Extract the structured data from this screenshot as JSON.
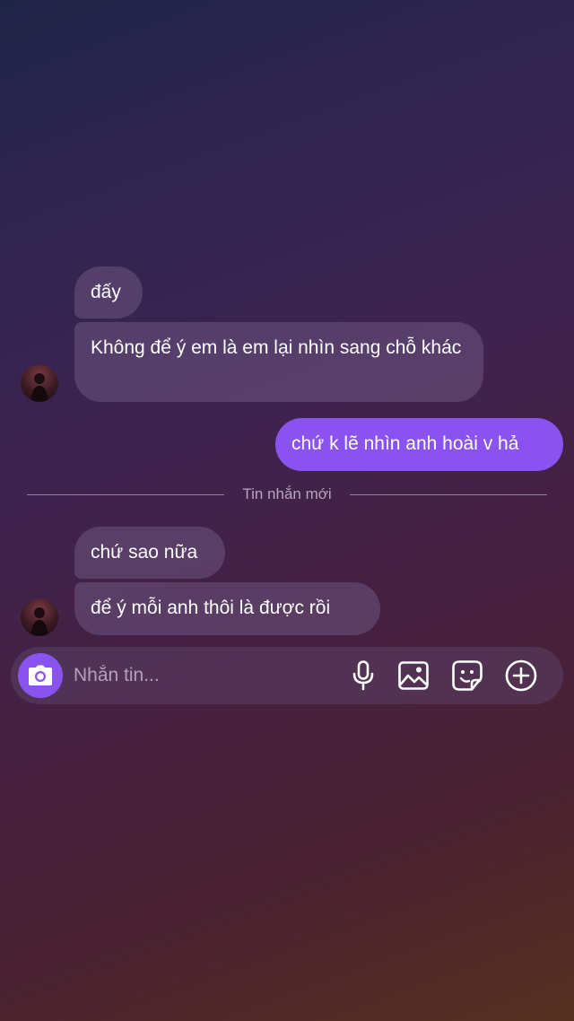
{
  "messages": [
    {
      "id": "m1",
      "direction": "incoming",
      "text": "đấy"
    },
    {
      "id": "m2",
      "direction": "incoming",
      "text": "Không để ý em là em lại nhìn sang chỗ khác"
    },
    {
      "id": "m3",
      "direction": "outgoing",
      "text": "chứ k lẽ nhìn anh hoài v hả"
    },
    {
      "id": "m4",
      "direction": "incoming",
      "text": "chứ sao nữa"
    },
    {
      "id": "m5",
      "direction": "incoming",
      "text": "để ý mỗi anh thôi là được rồi"
    }
  ],
  "divider": {
    "label": "Tin nhắn mới"
  },
  "composer": {
    "placeholder": "Nhắn tin..."
  },
  "icons": {
    "camera": "camera-icon",
    "microphone": "microphone-icon",
    "gallery": "image-gallery-icon",
    "sticker": "sticker-icon",
    "more": "plus-circle-icon"
  },
  "colors": {
    "accent": "#8a53f0",
    "incoming_bubble": "#6e5680"
  }
}
